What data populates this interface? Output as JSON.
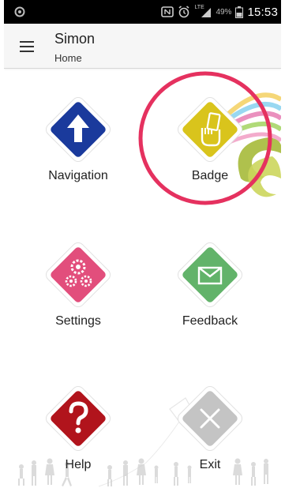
{
  "status_bar": {
    "left_icon": "android-debug-icon",
    "icons": [
      "nfc-icon",
      "alarm-icon",
      "lte-signal-icon"
    ],
    "network_label": "LTE",
    "battery_percent": "49%",
    "time": "15:53"
  },
  "app_bar": {
    "menu_icon": "hamburger-menu-icon",
    "title": "Simon",
    "subtitle": "Home"
  },
  "tiles": [
    {
      "label": "Navigation",
      "icon": "up-arrow-icon",
      "color": "#1a3a9c"
    },
    {
      "label": "Badge",
      "icon": "hand-card-icon",
      "color": "#d9c41c"
    },
    {
      "label": "Settings",
      "icon": "gears-icon",
      "color": "#e24e7c"
    },
    {
      "label": "Feedback",
      "icon": "envelope-icon",
      "color": "#62b36a"
    },
    {
      "label": "Help",
      "icon": "question-mark-icon",
      "color": "#b1141c"
    },
    {
      "label": "Exit",
      "icon": "close-x-icon",
      "color": "#c4c4c4"
    }
  ],
  "highlight_color": "#e5315f"
}
